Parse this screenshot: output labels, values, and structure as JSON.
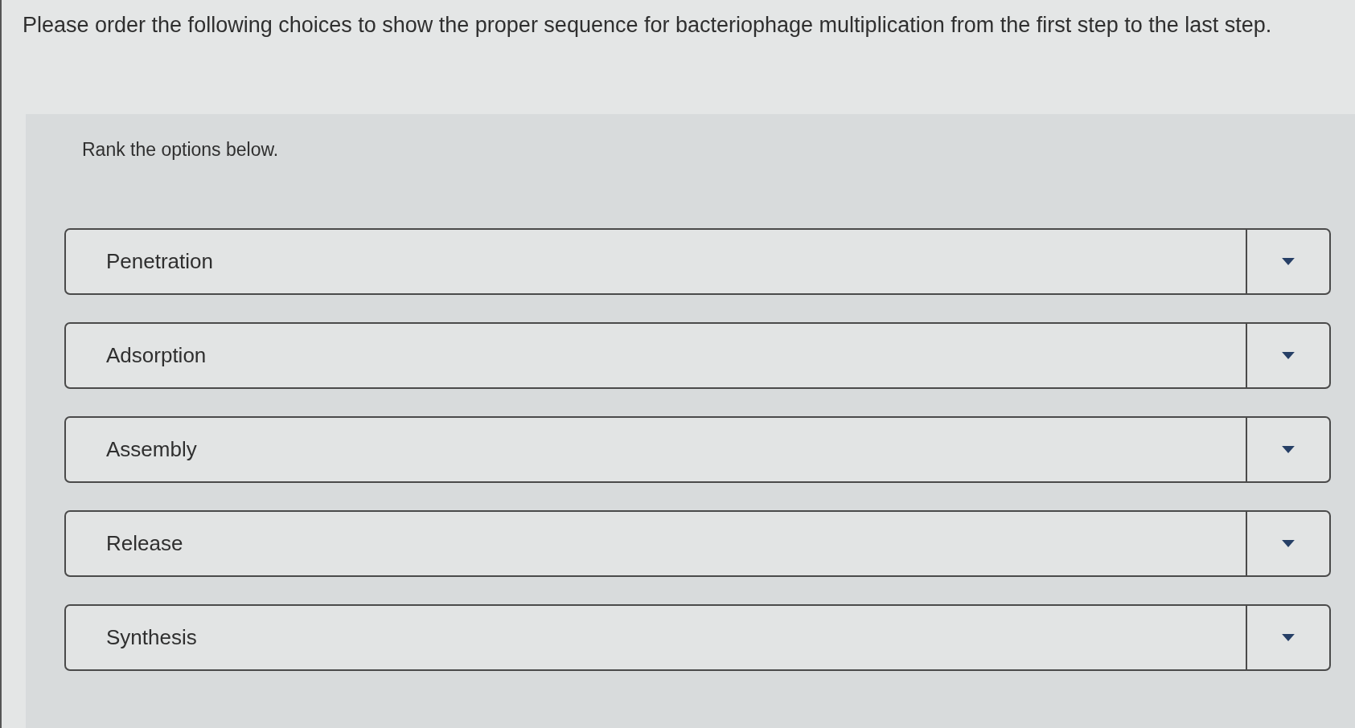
{
  "question": "Please order the following choices to show the proper sequence for bacteriophage multiplication from the first step to the last step.",
  "instruction": "Rank the options below.",
  "options": [
    {
      "label": "Penetration"
    },
    {
      "label": "Adsorption"
    },
    {
      "label": "Assembly"
    },
    {
      "label": "Release"
    },
    {
      "label": "Synthesis"
    }
  ]
}
